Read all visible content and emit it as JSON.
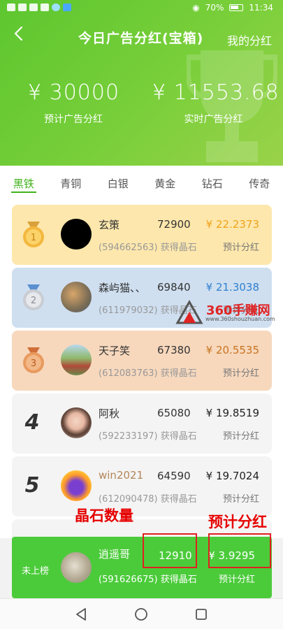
{
  "status_bar": {
    "battery": "70%",
    "time": "11:34"
  },
  "header": {
    "title": "今日广告分红(宝箱)",
    "my_bonus": "我的分红",
    "estimated_amount": "¥ 30000",
    "estimated_label": "预计广告分红",
    "realtime_amount": "¥ 11553.68",
    "realtime_label": "实时广告分红"
  },
  "tabs": [
    "黑铁",
    "青铜",
    "白银",
    "黄金",
    "钻石",
    "传奇"
  ],
  "active_tab": "黑铁",
  "rows": [
    {
      "rank": "1",
      "name": "玄策",
      "uid": "(594662563) 获得晶石",
      "count": "72900",
      "amount": "¥ 22.2373",
      "amount_label": "预计分红",
      "bg": "#fde7ac",
      "amount_color": "#f0a21a"
    },
    {
      "rank": "2",
      "name": "森屿猫、、",
      "uid": "(611979032) 获得晶石",
      "count": "69840",
      "amount": "¥ 21.3038",
      "amount_label": "预计分红",
      "bg": "#cfdff0",
      "amount_color": "#2f7fd0"
    },
    {
      "rank": "3",
      "name": "天子笑",
      "uid": "(612083763) 获得晶石",
      "count": "67380",
      "amount": "¥ 20.5535",
      "amount_label": "预计分红",
      "bg": "#f7d8bd",
      "amount_color": "#c8741f"
    },
    {
      "rank": "4",
      "name": "阿秋",
      "uid": "(592233197) 获得晶石",
      "count": "65080",
      "amount": "¥ 19.8519",
      "amount_label": "预计分红",
      "bg": "#f4f4f4",
      "amount_color": "#222222"
    },
    {
      "rank": "5",
      "name": "win2021",
      "uid": "(612090478) 获得晶石",
      "count": "64590",
      "amount": "¥ 19.7024",
      "amount_label": "预计分红",
      "bg": "#f4f4f4",
      "amount_color": "#222222"
    }
  ],
  "my_row": {
    "status": "未上榜",
    "name": "逍遥哥",
    "uid": "(591626675) 获得晶石",
    "count": "12910",
    "amount": "¥ 3.9295",
    "amount_label": "预计分红"
  },
  "annotations": {
    "crystals": "晶石数量",
    "bonus": "预计分红"
  },
  "watermark": {
    "text": "360手赚网",
    "url": "www.360shouzhuan.com"
  },
  "colors": {
    "header_green": "#6cca35",
    "accent": "#3fb21a",
    "my_row": "#4bcb3a",
    "annotation_red": "#e60000"
  }
}
